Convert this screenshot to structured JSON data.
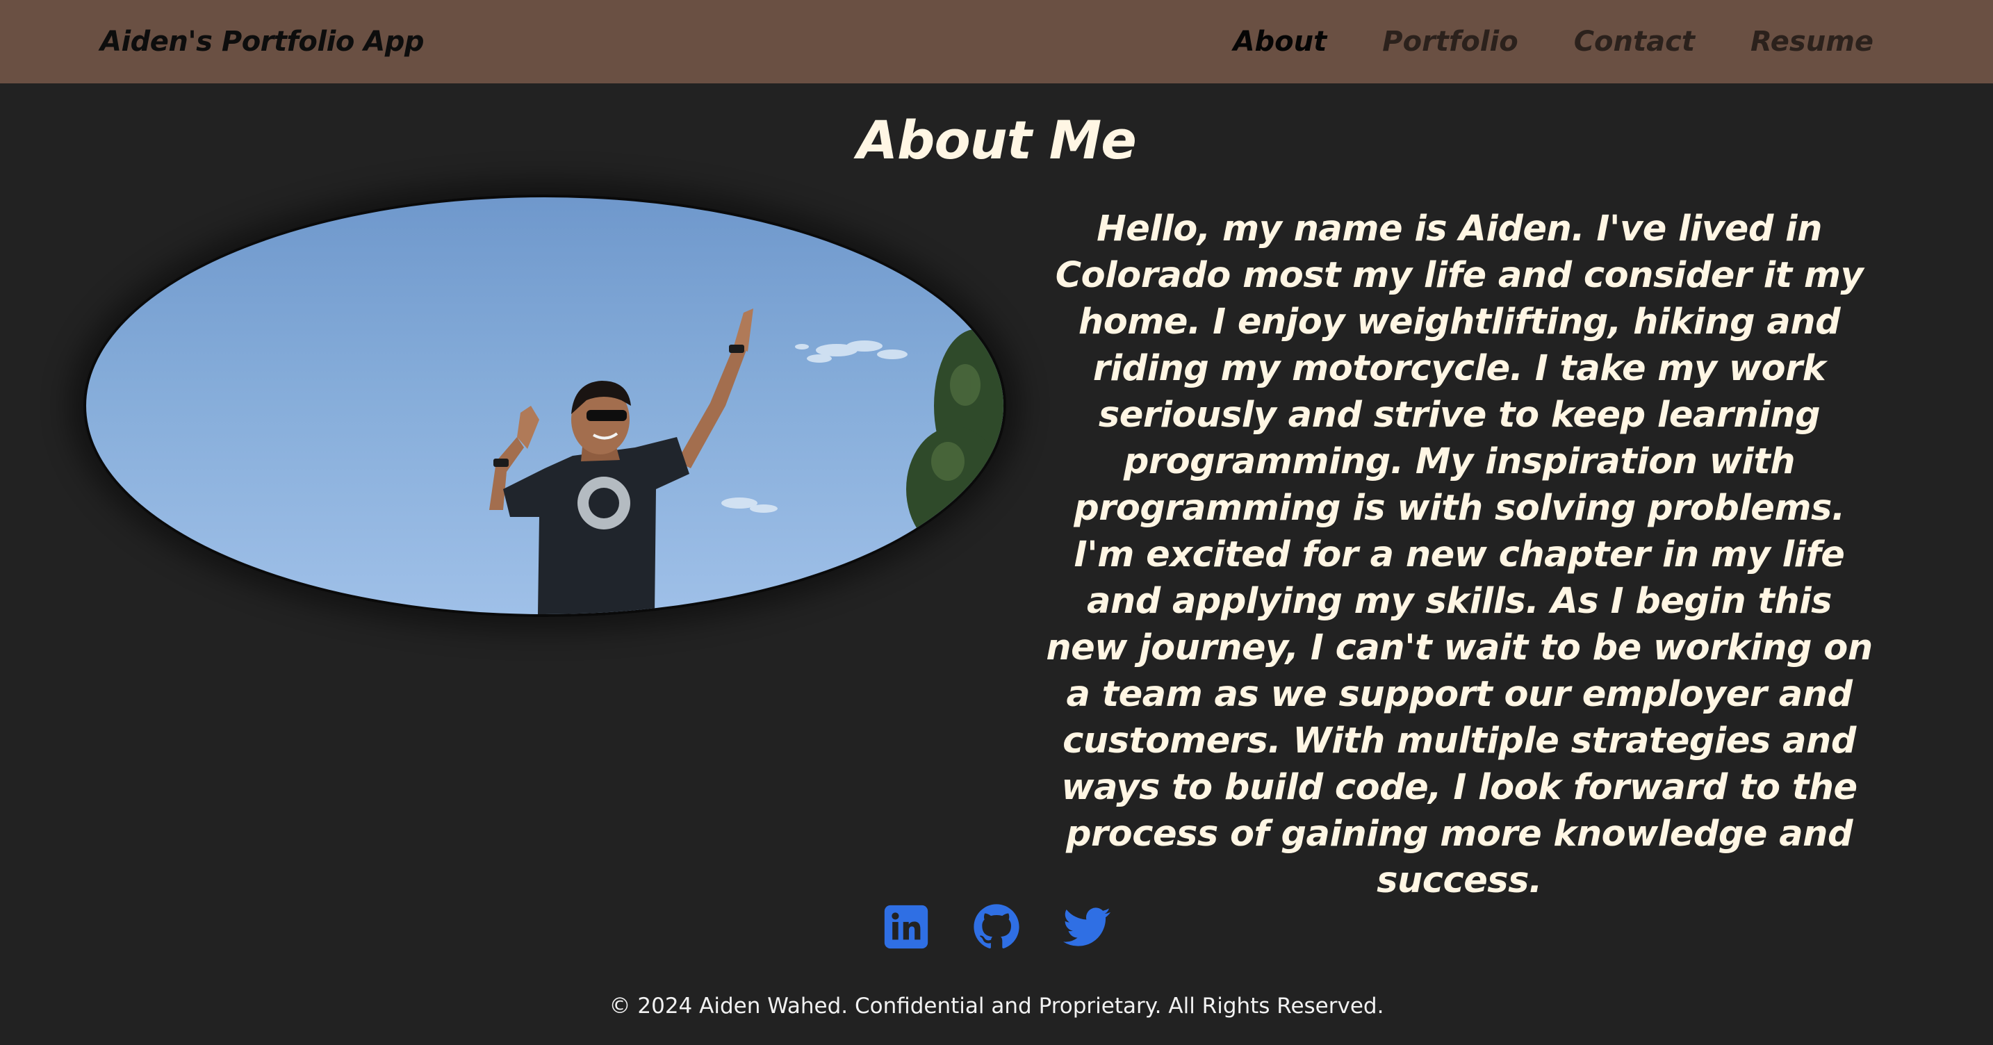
{
  "navbar": {
    "brand": "Aiden's Portfolio App",
    "links": [
      {
        "label": "About",
        "active": true
      },
      {
        "label": "Portfolio",
        "active": false
      },
      {
        "label": "Contact",
        "active": false
      },
      {
        "label": "Resume",
        "active": false
      }
    ]
  },
  "about": {
    "title": "About Me",
    "bio": "Hello, my name is Aiden. I've lived in Colorado most my life and consider it my home. I enjoy weightlifting, hiking and riding my motorcycle. I take my work seriously and strive to keep learning programming. My inspiration with programming is with solving problems. I'm excited for a new chapter in my life and applying my skills. As I begin this new journey, I can't wait to be working on a team as we support our employer and customers. With multiple strategies and ways to build code, I look forward to the process of gaining more knowledge and success."
  },
  "socials": [
    {
      "icon": "linkedin-icon"
    },
    {
      "icon": "github-icon"
    },
    {
      "icon": "twitter-icon"
    }
  ],
  "colors": {
    "navbar": "#6a5043",
    "background": "#222222",
    "text": "#fff6e4",
    "social": "#2f6fe4"
  },
  "footer": {
    "text": "© 2024 Aiden Wahed. Confidential and Proprietary. All Rights Reserved."
  }
}
